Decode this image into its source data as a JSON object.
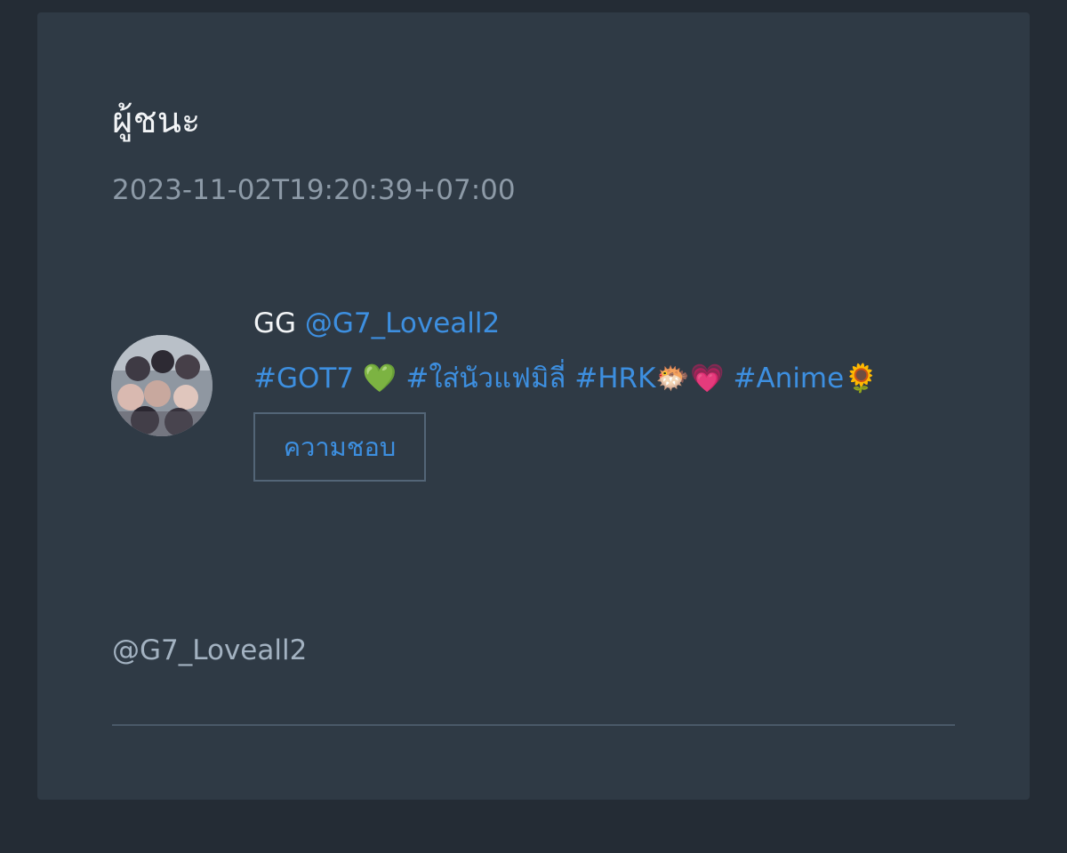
{
  "card": {
    "title": "ผู้ชนะ",
    "timestamp": "2023-11-02T19:20:39+07:00"
  },
  "user": {
    "display_name": "GG",
    "handle": "@G7_Loveall2",
    "bio_parts": [
      "#GOT7",
      "💚",
      "#ใส่นัวแฟมิลี่",
      "#HRK",
      "🐡",
      "💗",
      "#Anime",
      "🌻"
    ]
  },
  "follow_button": {
    "label": "ความชอบ"
  },
  "mention": {
    "text": "@G7_Loveall2"
  },
  "colors": {
    "page_background": "#242c35",
    "card_background": "#2f3a45",
    "link": "#3d8fe0",
    "muted_text": "#8d9aa7"
  }
}
